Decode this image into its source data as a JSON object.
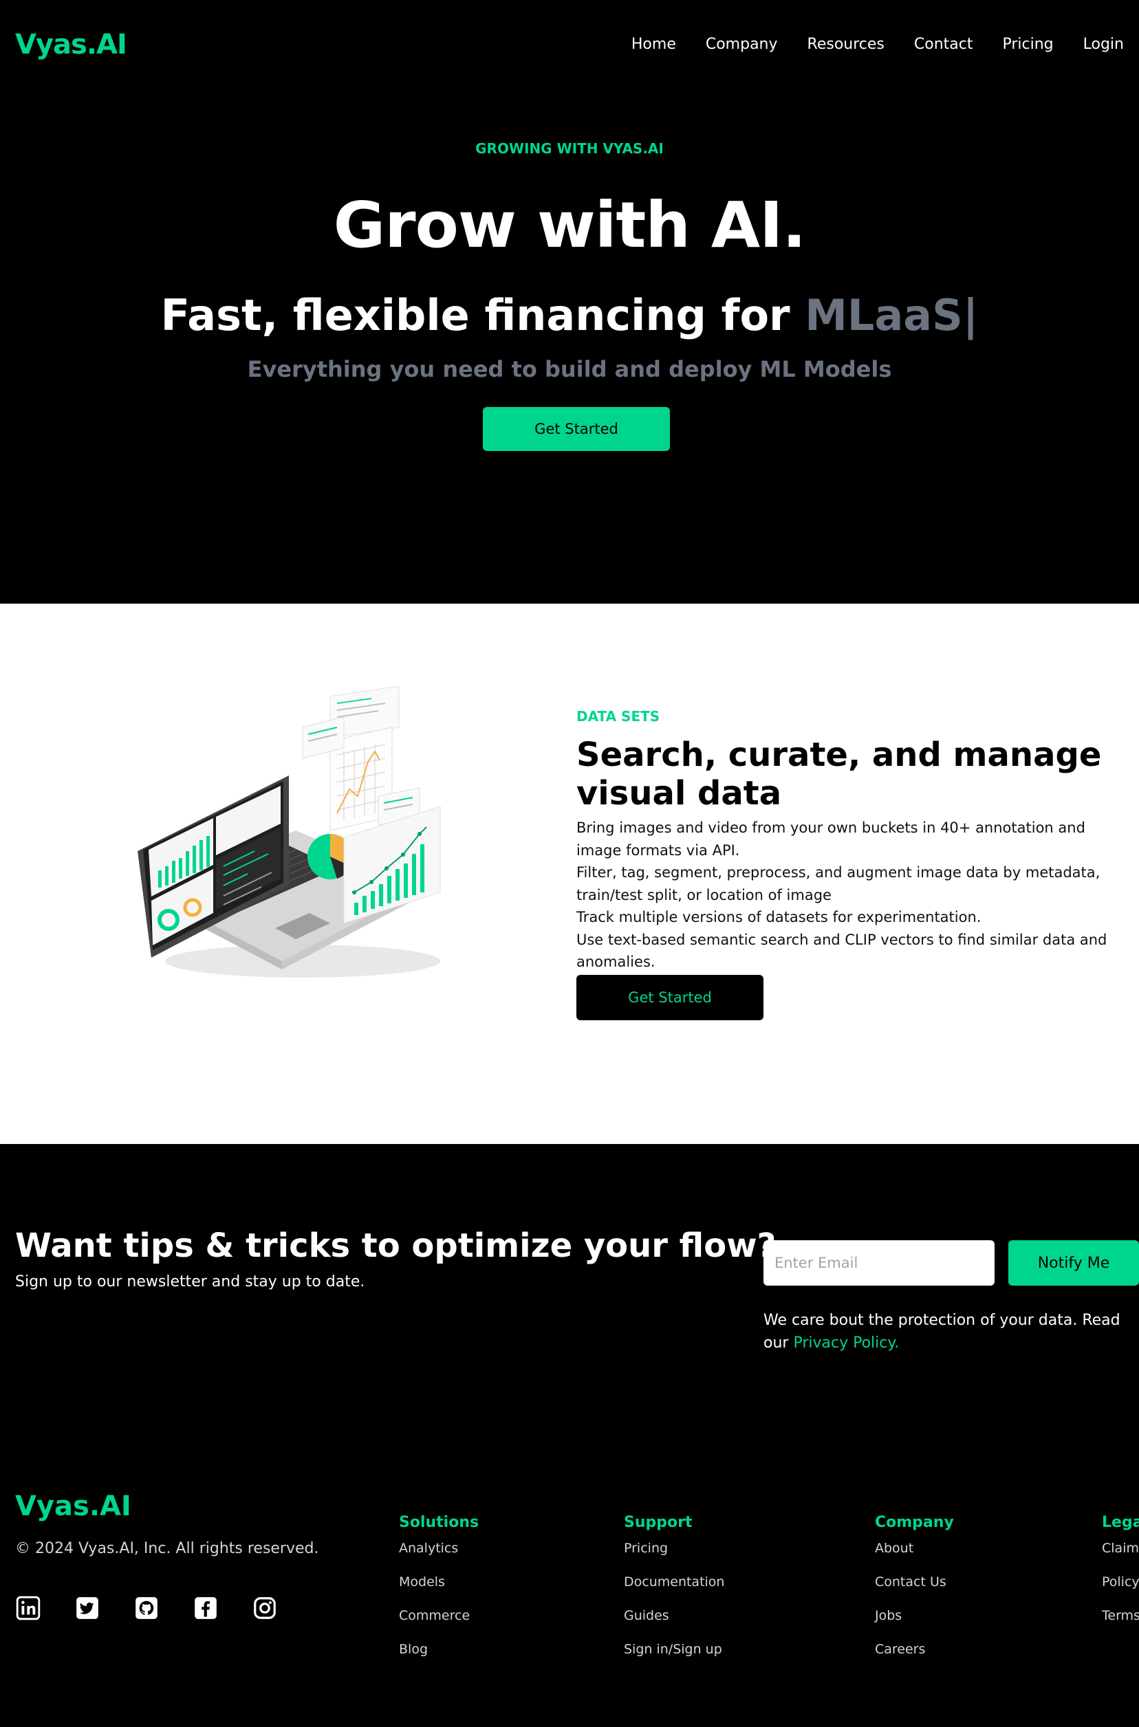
{
  "nav": {
    "logo": "Vyas.AI",
    "links": [
      "Home",
      "Company",
      "Resources",
      "Contact",
      "Pricing",
      "Login"
    ]
  },
  "hero": {
    "eyebrow": "GROWING WITH VYAS.AI",
    "title": "Grow with AI.",
    "subtitle_prefix": "Fast, flexible financing for ",
    "subtitle_typed": "MLaaS|",
    "description": "Everything you need to build and deploy ML Models",
    "cta": "Get Started"
  },
  "datasets": {
    "eyebrow": "DATA SETS",
    "title": "Search, curate, and manage visual data",
    "bullets": [
      "Bring images and video from your own buckets in 40+ annotation and image formats via API.",
      "Filter, tag, segment, preprocess, and augment image data by metadata, train/test split, or location of image",
      "Track multiple versions of datasets for experimentation.",
      "Use text-based semantic search and CLIP vectors to find similar data and anomalies."
    ],
    "cta": "Get Started"
  },
  "newsletter": {
    "title": "Want tips & tricks to optimize your flow?",
    "subtitle": "Sign up to our newsletter and stay up to date.",
    "email_placeholder": "Enter Email",
    "button": "Notify Me",
    "privacy_text": "We care bout the protection of your data. Read our ",
    "privacy_link": "Privacy Policy."
  },
  "footer": {
    "logo": "Vyas.AI",
    "copyright": "© 2024 Vyas.AI, Inc. All rights reserved.",
    "socials": [
      "linkedin-icon",
      "twitter-icon",
      "github-icon",
      "facebook-icon",
      "instagram-icon"
    ],
    "columns": [
      {
        "title": "Solutions",
        "items": [
          "Analytics",
          "Models",
          "Commerce",
          "Blog"
        ]
      },
      {
        "title": "Support",
        "items": [
          "Pricing",
          "Documentation",
          "Guides",
          "Sign in/Sign up"
        ]
      },
      {
        "title": "Company",
        "items": [
          "About",
          "Contact Us",
          "Jobs",
          "Careers"
        ]
      },
      {
        "title": "Legal",
        "items": [
          "Claim",
          "Policy",
          "Terms"
        ]
      }
    ]
  },
  "colors": {
    "accent": "#00D58F",
    "muted": "#6B7280",
    "background": "#000000"
  }
}
